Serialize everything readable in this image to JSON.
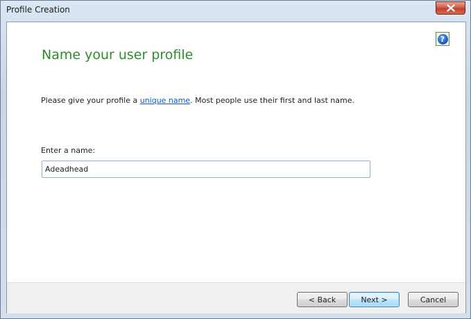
{
  "window": {
    "title": "Profile Creation",
    "close_icon": "close-icon"
  },
  "page": {
    "heading": "Name your user profile",
    "help_icon": "help-icon",
    "help_glyph": "?",
    "instructions_before": "Please give your profile a ",
    "instructions_link": "unique name",
    "instructions_after": ".  Most people use their first and last name.",
    "field_label": "Enter a name:",
    "name_value": "Adeadhead"
  },
  "buttons": {
    "back": "< Back",
    "next": "Next >",
    "cancel": "Cancel"
  },
  "colors": {
    "heading": "#2e8b2e",
    "link": "#0b5cbf",
    "close_button": "#c2402a"
  }
}
